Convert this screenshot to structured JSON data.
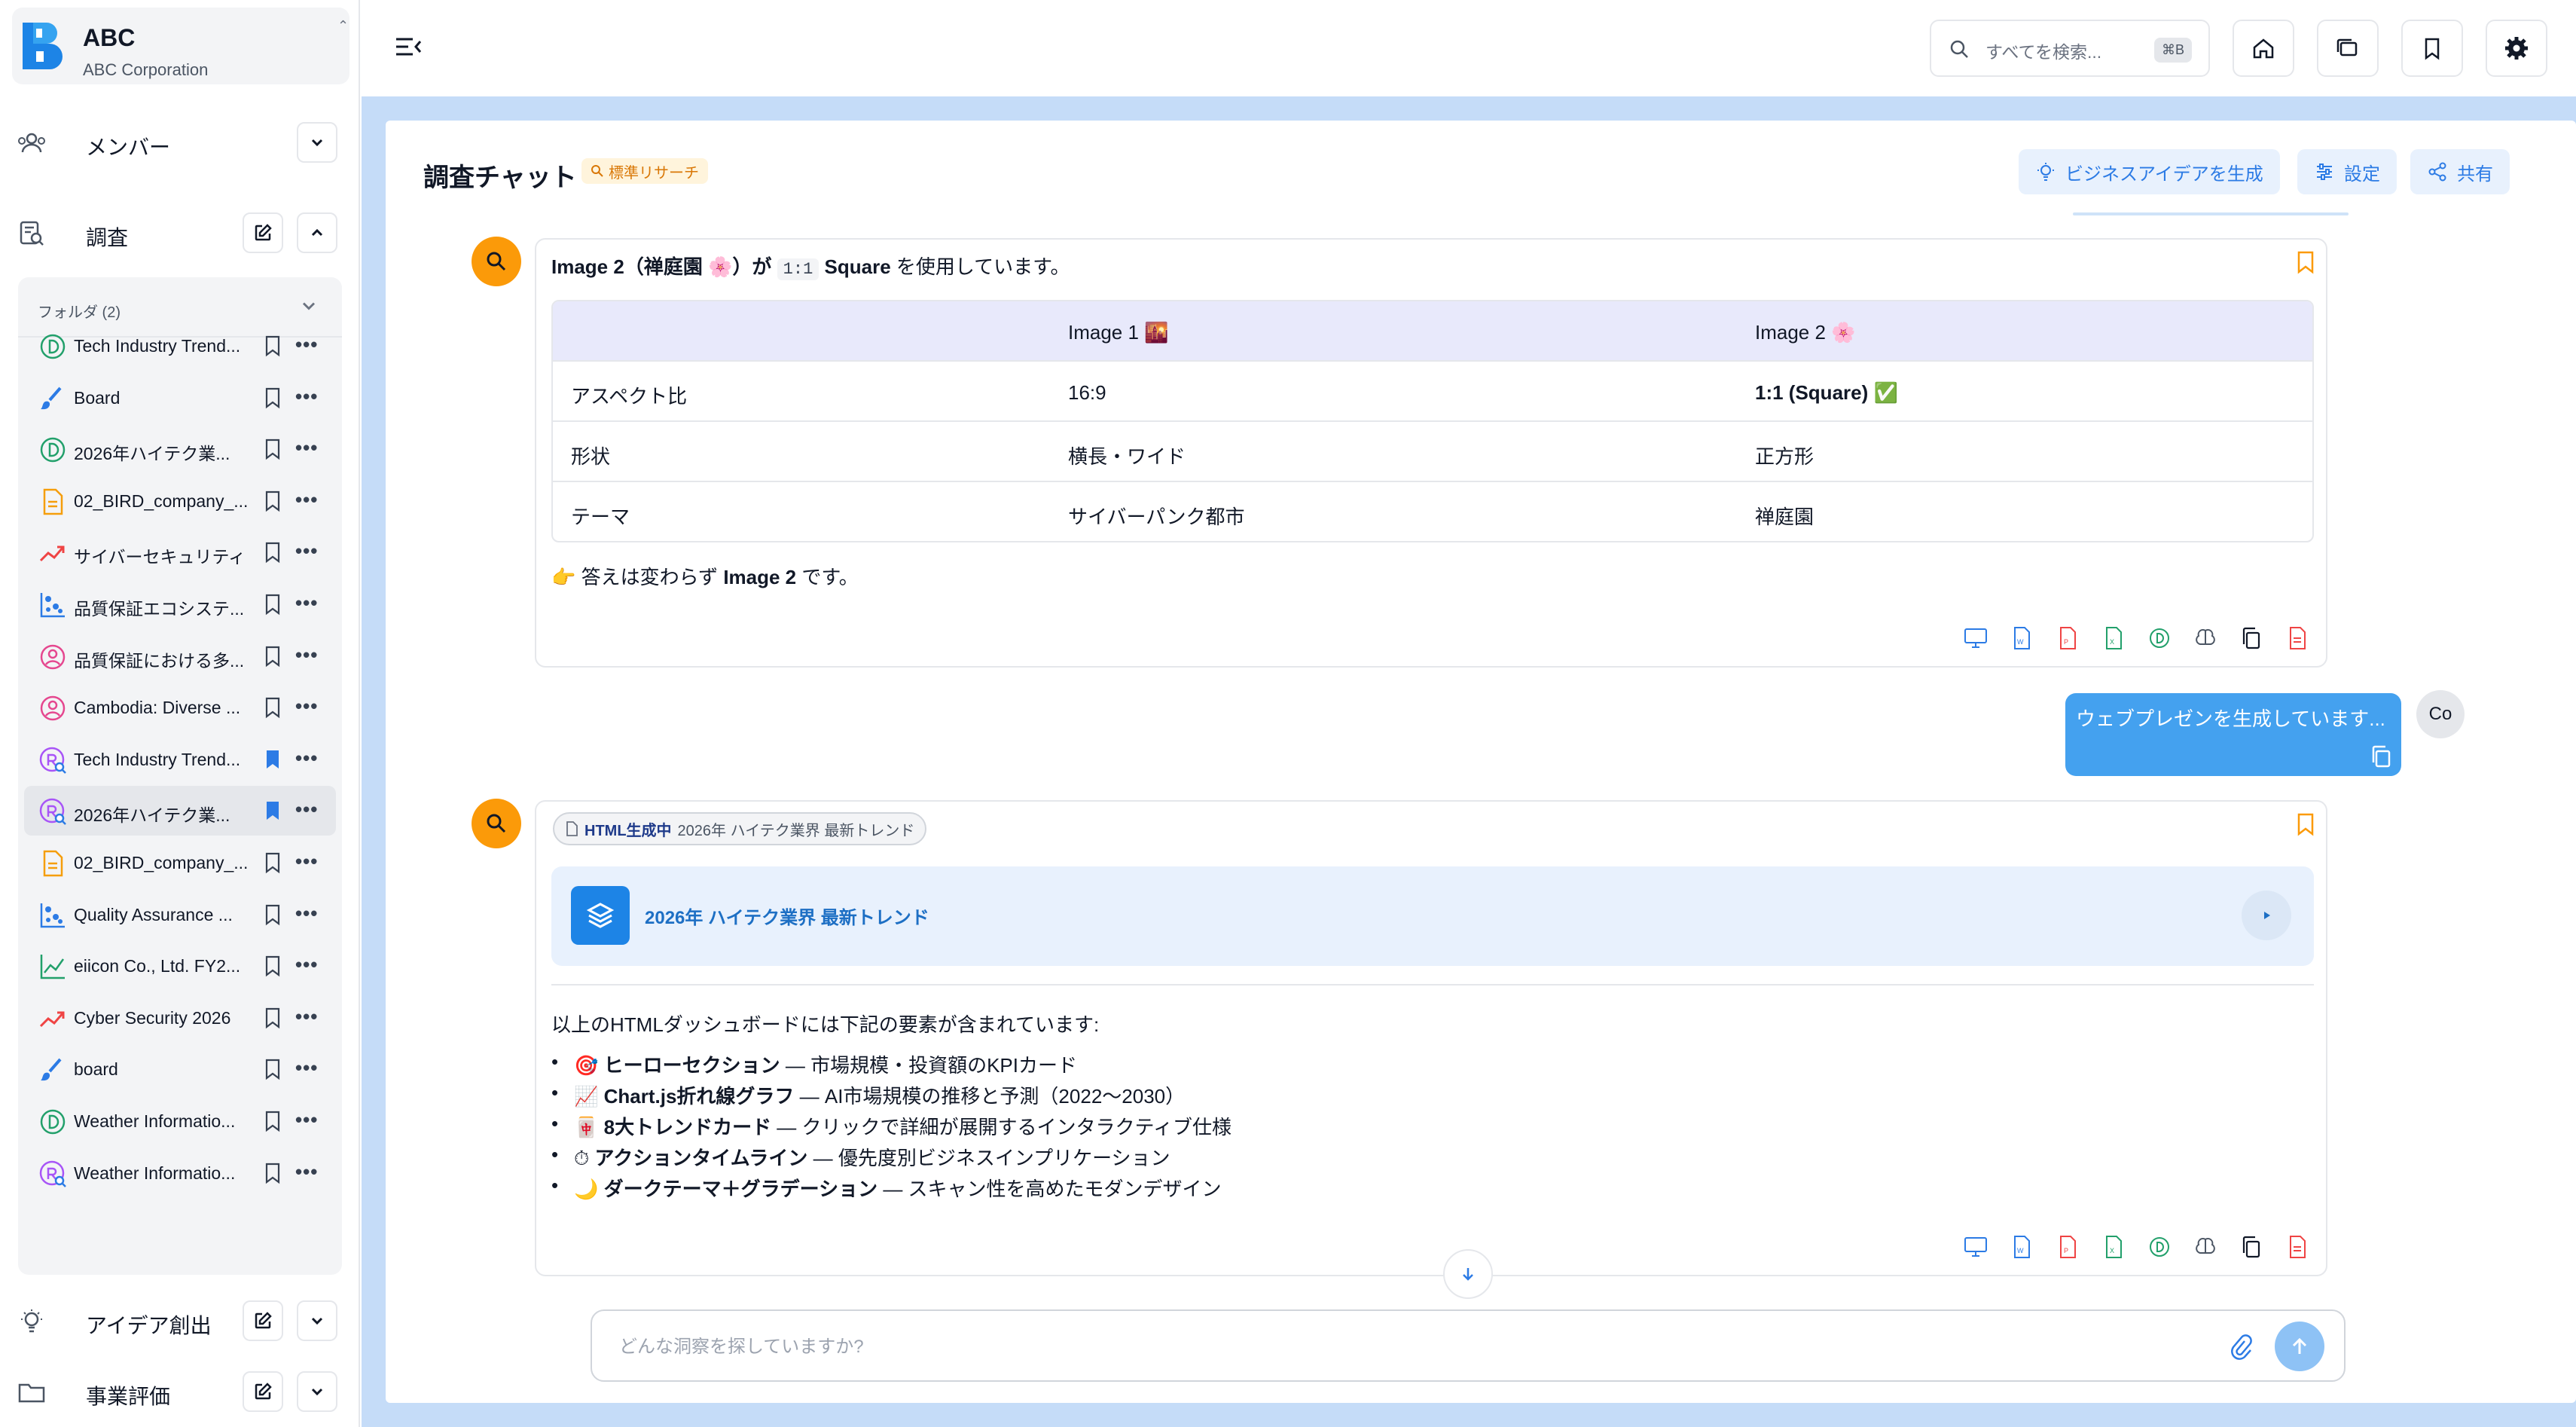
{
  "org": {
    "name": "ABC",
    "subtitle": "ABC Corporation"
  },
  "sidebar": {
    "members_label": "メンバー",
    "research_label": "調査",
    "folder_label": "フォルダ (2)",
    "items": [
      {
        "label": "Tech Industry Trend...",
        "icon": "d-circle-green-icon",
        "bookmarked": false
      },
      {
        "label": "Board",
        "icon": "brush-icon",
        "bookmarked": false
      },
      {
        "label": "2026年ハイテク業...",
        "icon": "d-circle-green-icon",
        "bookmarked": false
      },
      {
        "label": "02_BIRD_company_...",
        "icon": "document-orange-icon",
        "bookmarked": false
      },
      {
        "label": "サイバーセキュリティ",
        "icon": "trend-up-red-icon",
        "bookmarked": false
      },
      {
        "label": "品質保証エコシステ...",
        "icon": "scatter-blue-icon",
        "bookmarked": false
      },
      {
        "label": "品質保証における多...",
        "icon": "user-circle-pink-icon",
        "bookmarked": false
      },
      {
        "label": "Cambodia: Diverse ...",
        "icon": "user-circle-pink-icon",
        "bookmarked": false
      },
      {
        "label": "Tech Industry Trend...",
        "icon": "r-search-purple-icon",
        "bookmarked": true
      },
      {
        "label": "2026年ハイテク業...",
        "icon": "r-search-purple-icon",
        "bookmarked": true
      },
      {
        "label": "02_BIRD_company_...",
        "icon": "document-orange-icon",
        "bookmarked": false
      },
      {
        "label": "Quality Assurance ...",
        "icon": "scatter-blue-icon",
        "bookmarked": false
      },
      {
        "label": "eiicon Co., Ltd. FY2...",
        "icon": "line-chart-green-icon",
        "bookmarked": false
      },
      {
        "label": "Cyber Security 2026",
        "icon": "trend-up-red-icon",
        "bookmarked": false
      },
      {
        "label": "board",
        "icon": "brush-icon",
        "bookmarked": false
      },
      {
        "label": "Weather Informatio...",
        "icon": "d-circle-green-icon",
        "bookmarked": false
      },
      {
        "label": "Weather Informatio...",
        "icon": "r-search-purple-icon",
        "bookmarked": false
      }
    ],
    "ideas_label": "アイデア創出",
    "evaluation_label": "事業評価"
  },
  "search": {
    "placeholder": "すべてを検索...",
    "shortcut": "⌘B"
  },
  "chat": {
    "title": "調査チャット",
    "badge": "標準リサーチ",
    "actions": {
      "ideas": "ビジネスアイデアを生成",
      "settings": "設定",
      "share": "共有"
    }
  },
  "message1": {
    "intro_pre": "Image 2（禅庭園 🌸）が",
    "intro_code": "1:1",
    "intro_bold": "Square",
    "intro_post": "を使用しています。",
    "table": {
      "headers": [
        "",
        "Image 1 🌇",
        "Image 2 🌸"
      ],
      "rows": [
        [
          "アスペクト比",
          "16:9",
          "1:1 (Square) ✅"
        ],
        [
          "形状",
          "横長・ワイド",
          "正方形"
        ],
        [
          "テーマ",
          "サイバーパンク都市",
          "禅庭園"
        ]
      ]
    },
    "conclusion_pre": "👉 答えは変わらず",
    "conclusion_bold": "Image 2",
    "conclusion_post": "です。"
  },
  "user_message": {
    "text": "ウェブプレゼンを生成しています...",
    "avatar": "Co"
  },
  "message2": {
    "chip_status": "HTML生成中",
    "chip_title": "2026年 ハイテク業界 最新トレンド",
    "artifact_title": "2026年 ハイテク業界 最新トレンド",
    "intro": "以上のHTMLダッシュボードには下記の要素が含まれています:",
    "bullets": [
      {
        "emoji": "🎯",
        "bold": "ヒーローセクション",
        "rest": " — 市場規模・投資額のKPIカード"
      },
      {
        "emoji": "📈",
        "bold": "Chart.js折れ線グラフ",
        "rest": " — AI市場規模の推移と予測（2022〜2030）"
      },
      {
        "emoji": "🀄",
        "bold": "8大トレンドカード",
        "rest": " — クリックで詳細が展開するインタラクティブ仕様"
      },
      {
        "emoji": "⏱",
        "bold": "アクションタイムライン",
        "rest": " — 優先度別ビジネスインプリケーション"
      },
      {
        "emoji": "🌙",
        "bold": "ダークテーマ＋グラデーション",
        "rest": " — スキャン性を高めたモダンデザイン"
      }
    ]
  },
  "input": {
    "placeholder": "どんな洞察を探していますか?"
  },
  "colors": {
    "accent": "#2c7be5",
    "avatar_orange": "#fb9a09",
    "panel_bg": "#c5dcf8",
    "user_bubble": "#44a1ef"
  }
}
